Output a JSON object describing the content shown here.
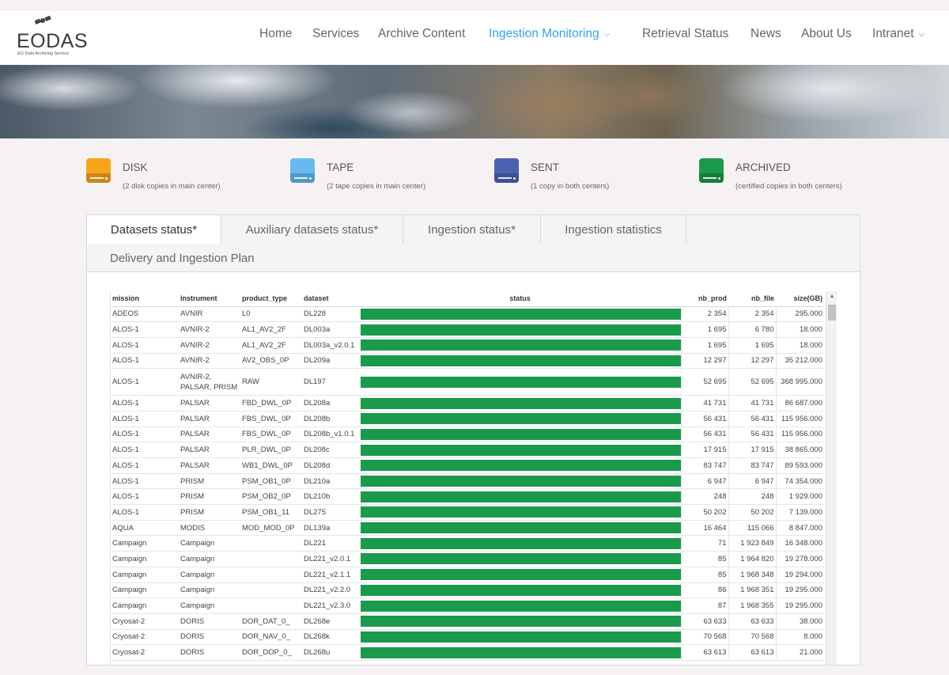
{
  "header": {
    "logo_text": "EODAS",
    "logo_tagline": "EO Data Archiving Service",
    "nav": [
      {
        "label": "Home"
      },
      {
        "label": "Services"
      },
      {
        "label": "Archive Content"
      },
      {
        "label": "Ingestion Monitoring",
        "active": true,
        "dropdown": true
      },
      {
        "label": "Retrieval Status"
      },
      {
        "label": "News"
      },
      {
        "label": "About Us"
      },
      {
        "label": "Intranet",
        "dropdown": true
      }
    ],
    "accent_color": "#2ea3f2"
  },
  "legend": [
    {
      "label": "DISK",
      "sub": "(2 disk copies in main center)",
      "color": "#f9a51a",
      "icon": "hard-drive-icon"
    },
    {
      "label": "TAPE",
      "sub": "(2 tape copies in main center)",
      "color": "#67baf0",
      "icon": "hard-drive-icon"
    },
    {
      "label": "SENT",
      "sub": "(1 copy in both centers)",
      "color": "#4a63b0",
      "icon": "hard-drive-icon"
    },
    {
      "label": "ARCHIVED",
      "sub": "(certified copies in both centers)",
      "color": "#1a9a4b",
      "icon": "hard-drive-icon"
    }
  ],
  "tabs": [
    {
      "label": "Datasets status*",
      "active": true
    },
    {
      "label": "Auxiliary datasets status*"
    },
    {
      "label": "Ingestion status*"
    },
    {
      "label": "Ingestion statistics"
    },
    {
      "label": "Delivery and Ingestion Plan"
    }
  ],
  "table": {
    "columns": [
      "mission",
      "instrument",
      "product_type",
      "dataset",
      "status",
      "nb_prod",
      "nb_file",
      "size(GB)"
    ],
    "status_color": "#1a9a4b",
    "rows": [
      {
        "mission": "ADEOS",
        "instrument": "AVNIR",
        "product_type": "L0",
        "dataset": "DL228",
        "archived_fraction": 1.0,
        "nb_prod": "2 354",
        "nb_file": "2 354",
        "size": "295.000"
      },
      {
        "mission": "ALOS-1",
        "instrument": "AVNIR-2",
        "product_type": "AL1_AV2_2F",
        "dataset": "DL003a",
        "archived_fraction": 1.0,
        "nb_prod": "1 695",
        "nb_file": "6 780",
        "size": "18.000"
      },
      {
        "mission": "ALOS-1",
        "instrument": "AVNIR-2",
        "product_type": "AL1_AV2_2F",
        "dataset": "DL003a_v2.0.1",
        "archived_fraction": 1.0,
        "nb_prod": "1 695",
        "nb_file": "1 695",
        "size": "18.000"
      },
      {
        "mission": "ALOS-1",
        "instrument": "AVNIR-2",
        "product_type": "AV2_OBS_0P",
        "dataset": "DL209a",
        "archived_fraction": 1.0,
        "nb_prod": "12 297",
        "nb_file": "12 297",
        "size": "35 212.000"
      },
      {
        "mission": "ALOS-1",
        "instrument": "AVNIR-2, PALSAR, PRISM",
        "product_type": "RAW",
        "dataset": "DL197",
        "archived_fraction": 1.0,
        "nb_prod": "52 695",
        "nb_file": "52 695",
        "size": "368 995.000"
      },
      {
        "mission": "ALOS-1",
        "instrument": "PALSAR",
        "product_type": "FBD_DWL_0P",
        "dataset": "DL208a",
        "archived_fraction": 1.0,
        "nb_prod": "41 731",
        "nb_file": "41 731",
        "size": "86 687.000"
      },
      {
        "mission": "ALOS-1",
        "instrument": "PALSAR",
        "product_type": "FBS_DWL_0P",
        "dataset": "DL208b",
        "archived_fraction": 1.0,
        "nb_prod": "56 431",
        "nb_file": "56 431",
        "size": "115 956.000"
      },
      {
        "mission": "ALOS-1",
        "instrument": "PALSAR",
        "product_type": "FBS_DWL_0P",
        "dataset": "DL208b_v1.0.1",
        "archived_fraction": 1.0,
        "nb_prod": "56 431",
        "nb_file": "56 431",
        "size": "115 956.000"
      },
      {
        "mission": "ALOS-1",
        "instrument": "PALSAR",
        "product_type": "PLR_DWL_0P",
        "dataset": "DL208c",
        "archived_fraction": 1.0,
        "nb_prod": "17 915",
        "nb_file": "17 915",
        "size": "38 865.000"
      },
      {
        "mission": "ALOS-1",
        "instrument": "PALSAR",
        "product_type": "WB1_DWL_0P",
        "dataset": "DL208d",
        "archived_fraction": 1.0,
        "nb_prod": "83 747",
        "nb_file": "83 747",
        "size": "89 593.000"
      },
      {
        "mission": "ALOS-1",
        "instrument": "PRISM",
        "product_type": "PSM_OB1_0P",
        "dataset": "DL210a",
        "archived_fraction": 1.0,
        "nb_prod": "6 947",
        "nb_file": "6 947",
        "size": "74 354.000"
      },
      {
        "mission": "ALOS-1",
        "instrument": "PRISM",
        "product_type": "PSM_OB2_0P",
        "dataset": "DL210b",
        "archived_fraction": 1.0,
        "nb_prod": "248",
        "nb_file": "248",
        "size": "1 929.000"
      },
      {
        "mission": "ALOS-1",
        "instrument": "PRISM",
        "product_type": "PSM_OB1_11",
        "dataset": "DL275",
        "archived_fraction": 1.0,
        "nb_prod": "50 202",
        "nb_file": "50 202",
        "size": "7 139.000"
      },
      {
        "mission": "AQUA",
        "instrument": "MODIS",
        "product_type": "MOD_MOD_0P",
        "dataset": "DL139a",
        "archived_fraction": 1.0,
        "nb_prod": "16 464",
        "nb_file": "115 066",
        "size": "8 847.000"
      },
      {
        "mission": "Campaign",
        "instrument": "Campaign",
        "product_type": "",
        "dataset": "DL221",
        "archived_fraction": 1.0,
        "nb_prod": "71",
        "nb_file": "1 923 849",
        "size": "16 348.000"
      },
      {
        "mission": "Campaign",
        "instrument": "Campaign",
        "product_type": "",
        "dataset": "DL221_v2.0.1",
        "archived_fraction": 1.0,
        "nb_prod": "85",
        "nb_file": "1 964 820",
        "size": "19 278.000"
      },
      {
        "mission": "Campaign",
        "instrument": "Campaign",
        "product_type": "",
        "dataset": "DL221_v2.1.1",
        "archived_fraction": 1.0,
        "nb_prod": "85",
        "nb_file": "1 968 348",
        "size": "19 294.000"
      },
      {
        "mission": "Campaign",
        "instrument": "Campaign",
        "product_type": "",
        "dataset": "DL221_v2.2.0",
        "archived_fraction": 1.0,
        "nb_prod": "86",
        "nb_file": "1 968 351",
        "size": "19 295.000"
      },
      {
        "mission": "Campaign",
        "instrument": "Campaign",
        "product_type": "",
        "dataset": "DL221_v2.3.0",
        "archived_fraction": 1.0,
        "nb_prod": "87",
        "nb_file": "1 968 355",
        "size": "19 295.000"
      },
      {
        "mission": "Cryosat-2",
        "instrument": "DORIS",
        "product_type": "DOR_DAT_0_",
        "dataset": "DL268e",
        "archived_fraction": 1.0,
        "nb_prod": "63 633",
        "nb_file": "63 633",
        "size": "38.000"
      },
      {
        "mission": "Cryosat-2",
        "instrument": "DORIS",
        "product_type": "DOR_NAV_0_",
        "dataset": "DL268k",
        "archived_fraction": 1.0,
        "nb_prod": "70 568",
        "nb_file": "70 568",
        "size": "8.000"
      },
      {
        "mission": "Cryosat-2",
        "instrument": "DORIS",
        "product_type": "DOR_DOP_0_",
        "dataset": "DL268u",
        "archived_fraction": 1.0,
        "nb_prod": "63 613",
        "nb_file": "63 613",
        "size": "21.000"
      }
    ]
  }
}
